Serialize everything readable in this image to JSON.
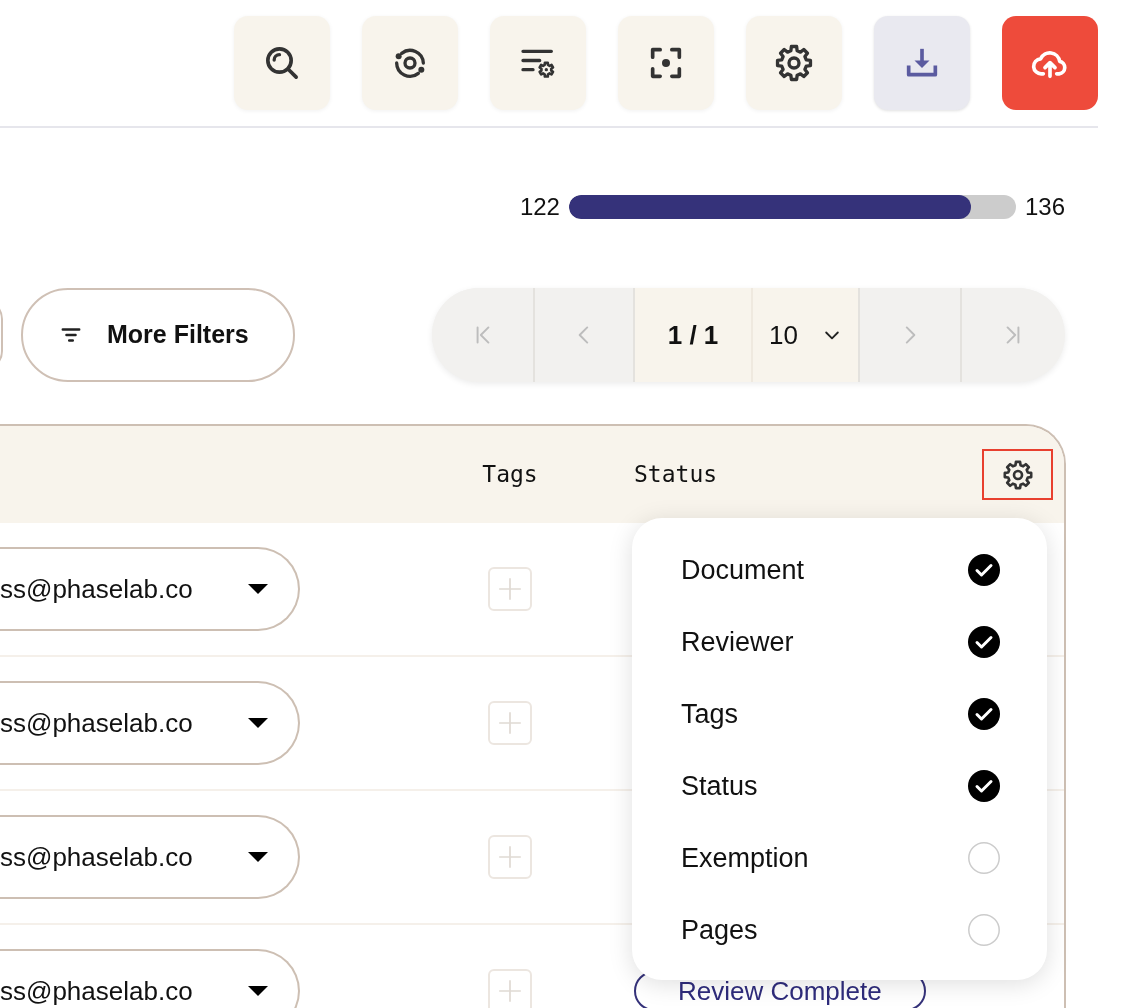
{
  "toolbar": {
    "buttons": [
      {
        "selected": false
      },
      {
        "selected": false
      },
      {
        "selected": false
      },
      {
        "selected": false
      },
      {
        "selected": false
      },
      {
        "selected": true
      },
      {
        "selected": false
      }
    ]
  },
  "progress": {
    "start": "122",
    "end": "136",
    "level": 0.9
  },
  "filters": {
    "more_filters": "More Filters"
  },
  "pagination": {
    "first": {
      "disabled": true
    },
    "previous": {
      "disabled": true
    },
    "page": "1 / 1",
    "page_size": "10",
    "next": {
      "disabled": true
    },
    "last": {
      "disabled": true
    }
  },
  "table": {
    "columns": [
      {
        "label": "Tags"
      },
      {
        "label": "Status"
      }
    ],
    "settings_button": {
      "focused": true
    },
    "rows": [
      {
        "reviewer": "ss@phaselab.co"
      },
      {
        "reviewer": "ss@phaselab.co"
      },
      {
        "reviewer": "ss@phaselab.co"
      },
      {
        "reviewer": "ss@phaselab.co",
        "status": "Review Complete"
      }
    ]
  },
  "column_menu": {
    "items": [
      {
        "label": "Document",
        "checked": true
      },
      {
        "label": "Reviewer",
        "checked": true
      },
      {
        "label": "Tags",
        "checked": true
      },
      {
        "label": "Status",
        "checked": true
      },
      {
        "label": "Exemption",
        "checked": false
      },
      {
        "label": "Pages",
        "checked": false
      }
    ]
  }
}
